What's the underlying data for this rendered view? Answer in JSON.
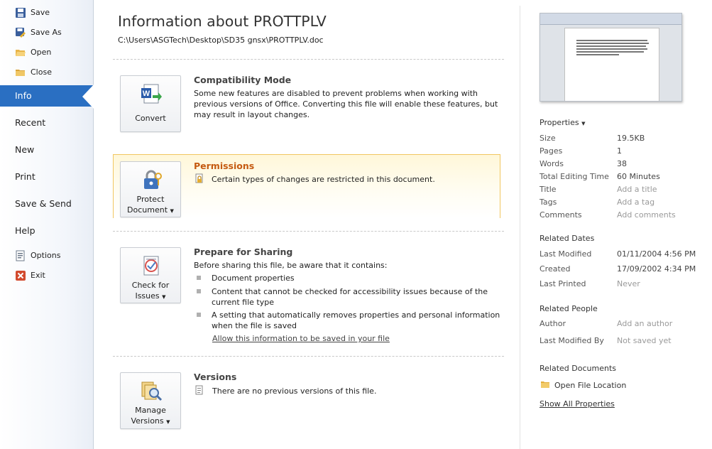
{
  "nav": {
    "save": "Save",
    "save_as": "Save As",
    "open": "Open",
    "close": "Close",
    "info": "Info",
    "recent": "Recent",
    "new": "New",
    "print": "Print",
    "save_send": "Save & Send",
    "help": "Help",
    "options": "Options",
    "exit": "Exit"
  },
  "main": {
    "title": "Information about PROTTPLV",
    "path": "C:\\Users\\ASGTech\\Desktop\\SD35 gnsx\\PROTTPLV.doc",
    "compat": {
      "heading": "Compatibility Mode",
      "lines": [
        "Some new features are disabled to prevent problems when working with",
        "previous versions of Office. Converting this file will enable these features, but",
        "may result in layout changes."
      ],
      "button": "Convert"
    },
    "permissions": {
      "heading": "Permissions",
      "text": "Certain types of changes are restricted in this document.",
      "button_line1": "Protect",
      "button_line2": "Document"
    },
    "sharing": {
      "heading": "Prepare for Sharing",
      "intro": "Before sharing this file, be aware that it contains:",
      "items": [
        [
          "Document properties"
        ],
        [
          "Content that cannot be checked for accessibility issues because of the",
          "current file type"
        ],
        [
          "A setting that automatically removes properties and personal information",
          "when the file is saved"
        ]
      ],
      "link": "Allow this information to be saved in your file",
      "button_line1": "Check for",
      "button_line2": "Issues"
    },
    "versions": {
      "heading": "Versions",
      "text": "There are no previous versions of this file.",
      "button_line1": "Manage",
      "button_line2": "Versions"
    }
  },
  "properties": {
    "heading": "Properties",
    "size_k": "Size",
    "size_v": "19.5KB",
    "pages_k": "Pages",
    "pages_v": "1",
    "words_k": "Words",
    "words_v": "38",
    "editing_k": "Total Editing Time",
    "editing_v": "60 Minutes",
    "title_k": "Title",
    "title_v": "Add a title",
    "tags_k": "Tags",
    "tags_v": "Add a tag",
    "comments_k": "Comments",
    "comments_v": "Add comments"
  },
  "dates": {
    "heading": "Related Dates",
    "modified_k": "Last Modified",
    "modified_v": "01/11/2004 4:56 PM",
    "created_k": "Created",
    "created_v": "17/09/2002 4:34 PM",
    "printed_k": "Last Printed",
    "printed_v": "Never"
  },
  "people": {
    "heading": "Related People",
    "author_k": "Author",
    "author_v": "Add an author",
    "modby_k": "Last Modified By",
    "modby_v": "Not saved yet"
  },
  "documents": {
    "heading": "Related Documents",
    "open_location": "Open File Location",
    "show_all": "Show All Properties"
  }
}
